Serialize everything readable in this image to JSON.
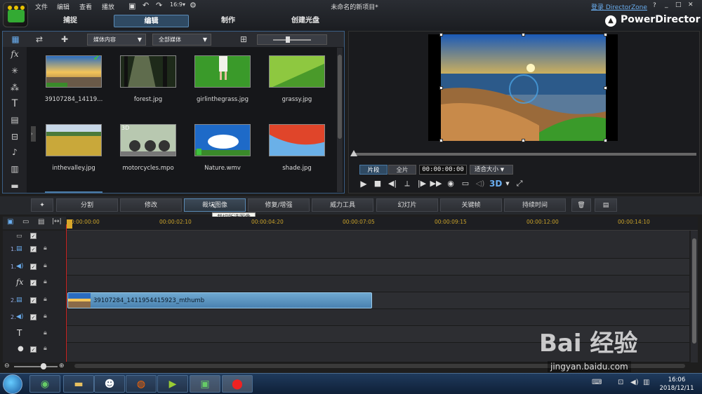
{
  "menu": [
    "文件",
    "编辑",
    "查看",
    "播放"
  ],
  "window_title": "未命名的新项目*",
  "login_link": "登录 DirectorZone",
  "help": "?",
  "brand": "PowerDirector",
  "tabs": [
    "捕捉",
    "编辑",
    "制作",
    "创建光盘"
  ],
  "library": {
    "content_dropdown": "媒体内容",
    "filter_dropdown": "全部媒体",
    "items": [
      {
        "label": "39107284_14119..."
      },
      {
        "label": "forest.jpg"
      },
      {
        "label": "girlinthegrass.jpg"
      },
      {
        "label": "grassy.jpg"
      },
      {
        "label": "inthevalley.jpg"
      },
      {
        "label": "motorcycles.mpo",
        "badge": "3D"
      },
      {
        "label": "Nature.wmv"
      },
      {
        "label": "shade.jpg"
      }
    ]
  },
  "preview": {
    "seg_clip": "片段",
    "seg_full": "全片",
    "timecode": "00:00:00:00",
    "fit": "适合大小"
  },
  "functions": [
    "分割",
    "修改",
    "裁切图像",
    "修复/增强",
    "威力工具",
    "幻灯片",
    "关键帧",
    "持续时间"
  ],
  "tooltip": "裁切所选图像",
  "ruler": [
    "00:00:00:00",
    "00:00:02:10",
    "00:00:04:20",
    "00:00:07:05",
    "00:00:09:15",
    "00:00:12:00",
    "00:00:14:10"
  ],
  "tracks": [
    {
      "num": "",
      "type": "master"
    },
    {
      "num": "1.",
      "type": "video"
    },
    {
      "num": "1.",
      "type": "audio"
    },
    {
      "num": "",
      "type": "fx"
    },
    {
      "num": "2.",
      "type": "video"
    },
    {
      "num": "2.",
      "type": "audio"
    },
    {
      "num": "",
      "type": "title"
    },
    {
      "num": "",
      "type": "voice"
    }
  ],
  "clip_label": "39107284_1411954415923_mthumb",
  "taskbar": {
    "time": "16:06",
    "date": "2018/12/11"
  },
  "watermark": "Bai 经验",
  "watermark_url": "jingyan.baidu.com"
}
